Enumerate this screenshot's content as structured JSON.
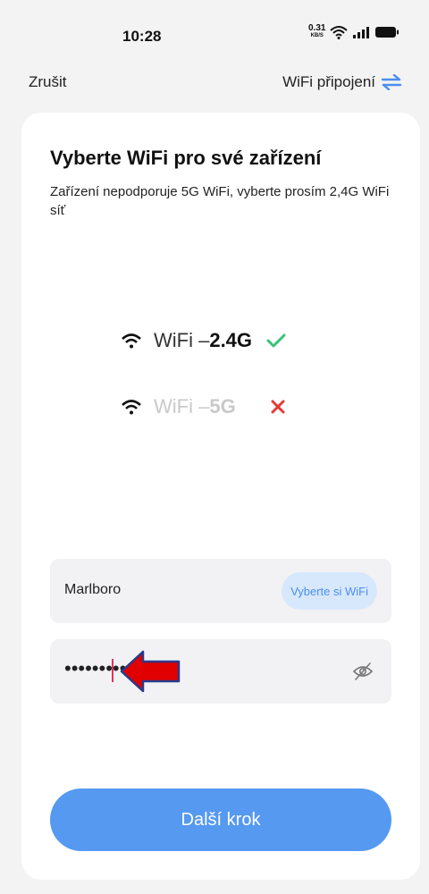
{
  "status_bar": {
    "time": "10:28",
    "net_speed_value": "0.31",
    "net_speed_unit": "KB/S",
    "icons": [
      "wifi-icon",
      "signal-icon",
      "battery-icon"
    ]
  },
  "header": {
    "cancel_label": "Zrušit",
    "wifi_connection_label": "WiFi připojení",
    "swap_icon": "swap-arrows-icon"
  },
  "card": {
    "title": "Vyberte WiFi pro své zařízení",
    "subtitle": "Zařízení nepodporuje 5G WiFi, vyberte prosím 2,4G WiFi síť",
    "bands": [
      {
        "prefix": "WiFi – ",
        "band": "2.4G",
        "supported": true,
        "icon": "check-icon"
      },
      {
        "prefix": "WiFi – ",
        "band": "5G",
        "supported": false,
        "icon": "cross-icon"
      }
    ],
    "ssid_value": "Marlboro",
    "select_wifi_label": "Vyberte si WiFi",
    "password_value": "•••••••••",
    "next_button_label": "Další krok"
  },
  "colors": {
    "accent": "#5599f0",
    "check": "#3cc07a",
    "cross": "#e53935",
    "annotation_arrow": "#e00000"
  }
}
